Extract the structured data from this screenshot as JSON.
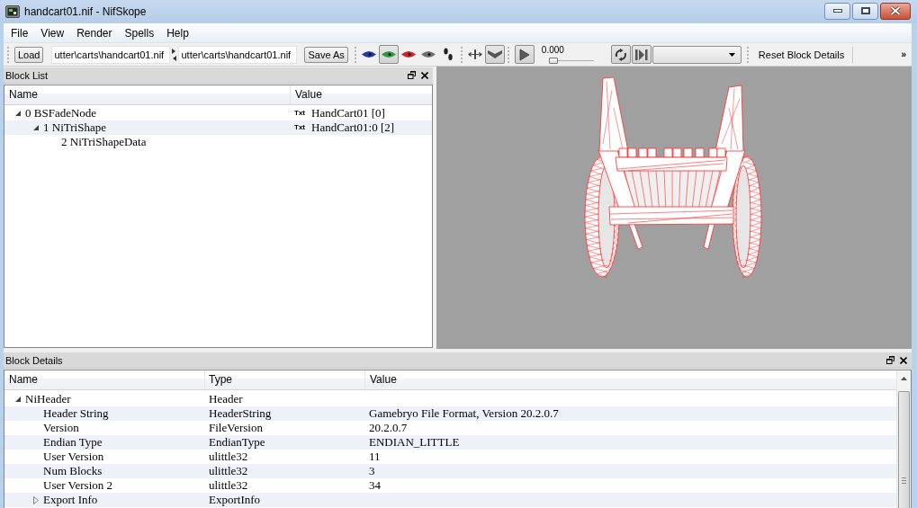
{
  "window": {
    "title": "handcart01.nif - NifSkope"
  },
  "menu": [
    {
      "label": "File"
    },
    {
      "label": "View"
    },
    {
      "label": "Render"
    },
    {
      "label": "Spells"
    },
    {
      "label": "Help"
    }
  ],
  "toolbar": {
    "load": "Load",
    "paths": [
      {
        "value": "utter\\carts\\handcart01.nif"
      },
      {
        "value": "utter\\carts\\handcart01.nif"
      }
    ],
    "save_as": "Save As",
    "view_modes": [
      {
        "kind": "eye",
        "color": "#2438a8",
        "selected": false
      },
      {
        "kind": "eye",
        "color": "#2a9a3c",
        "selected": true
      },
      {
        "kind": "eye",
        "color": "#c8242a",
        "selected": false
      },
      {
        "kind": "eye",
        "color": "#707070",
        "selected": false
      },
      {
        "kind": "footprints",
        "selected": false
      }
    ],
    "tools": [
      {
        "kind": "arrows",
        "on": false
      },
      {
        "kind": "chevron",
        "on": true
      }
    ],
    "play": {
      "on": true
    },
    "time": "0.000",
    "time_slider": {
      "level": 0
    },
    "loop_controls": [
      {
        "kind": "loop",
        "on": true
      },
      {
        "kind": "step",
        "on": true
      }
    ],
    "reset": "Reset Block Details",
    "overflow": "»"
  },
  "block_list": {
    "title": "Block List",
    "columns": [
      "Name",
      "Value"
    ],
    "rows": [
      {
        "name": "0 BSFadeNode",
        "value_tag": "Txt",
        "value": "HandCart01 [0]",
        "expanded": true,
        "children": [
          {
            "name": "1 NiTriShape",
            "value_tag": "Txt",
            "value": "HandCart01:0 [2]",
            "expanded": true,
            "children": [
              {
                "name": "2 NiTriShapeData"
              }
            ]
          }
        ]
      }
    ]
  },
  "block_details": {
    "title": "Block Details",
    "columns": [
      "Name",
      "Type",
      "Value"
    ],
    "rows": [
      {
        "name": "NiHeader",
        "type": "Header",
        "expanded": true,
        "children": [
          {
            "name": "Header String",
            "type": "HeaderString",
            "value": "Gamebryo File Format, Version 20.2.0.7"
          },
          {
            "name": "Version",
            "type": "FileVersion",
            "value": "20.2.0.7"
          },
          {
            "name": "Endian Type",
            "type": "EndianType",
            "value": "ENDIAN_LITTLE"
          },
          {
            "name": "User Version",
            "type": "ulittle32",
            "value": "11"
          },
          {
            "name": "Num Blocks",
            "type": "ulittle32",
            "value": "3"
          },
          {
            "name": "User Version 2",
            "type": "ulittle32",
            "value": "34"
          },
          {
            "name": "Export Info",
            "type": "ExportInfo",
            "expanded": false
          }
        ]
      }
    ]
  }
}
